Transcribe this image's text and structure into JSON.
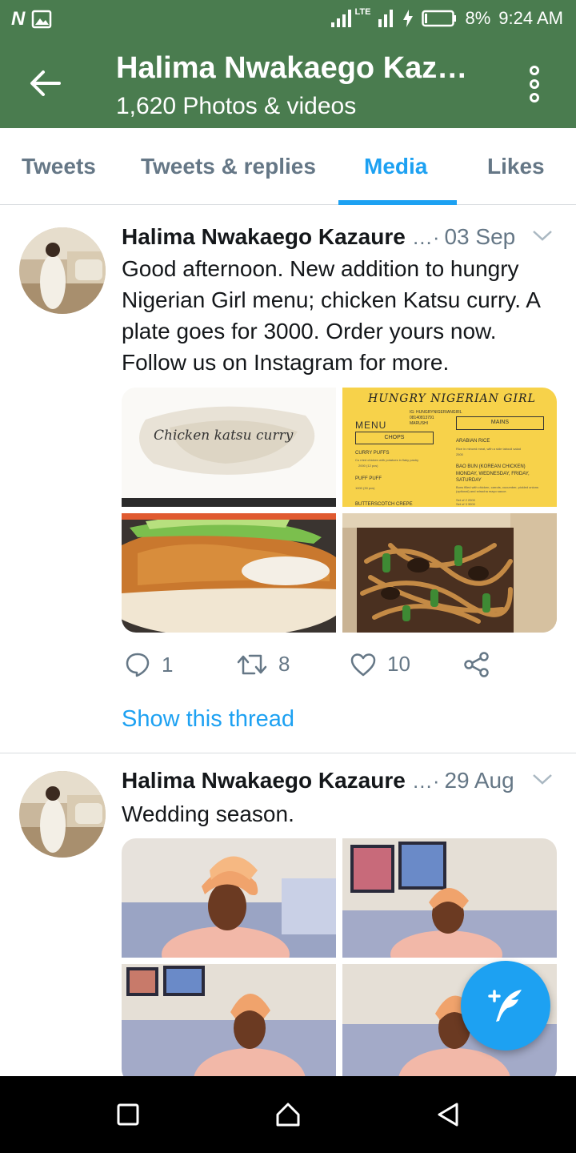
{
  "status_bar": {
    "left_icons": [
      "n-icon",
      "image-icon"
    ],
    "network": "LTE",
    "battery": "8%",
    "time": "9:24 AM"
  },
  "header": {
    "title": "Halima Nwakaego Kaza…",
    "subtitle": "1,620 Photos & videos"
  },
  "tabs": [
    {
      "label": "Tweets",
      "active": false
    },
    {
      "label": "Tweets & replies",
      "active": false
    },
    {
      "label": "Media",
      "active": true
    },
    {
      "label": "Likes",
      "active": false
    }
  ],
  "tweets": [
    {
      "author": "Halima Nwakaego Kazaure",
      "sep": "…·",
      "date": "03 Sep",
      "text": "Good afternoon. New addition to hungry Nigerian Girl menu; chicken Katsu curry. A plate goes for 3000. Order yours now. Follow us on Instagram for more.",
      "media": {
        "img1_text": "Chicken katsu curry",
        "menu_title": "HUNGRY NIGERIAN GIRL",
        "menu_label": "MENU",
        "menu_handle": "IG: HUNGRYNIGERIANGIRL",
        "menu_phone": "08140813791",
        "menu_city": "MARUSHI",
        "chops_label": "CHOPS",
        "mains_label": "MAINS",
        "item_curry_puffs": "CURRY PUFFS",
        "item_curry_puffs_desc": "Cu rried chicken with potatoes in flaky pastry",
        "item_curry_puffs_price": "2000 (12 pcs)",
        "item_puff_puff": "PUFF PUFF",
        "item_puff_puff_price": "1000 (30 pcs)",
        "item_butterscotch": "BUTTERSCOTCH CREPE",
        "item_arabian_rice": "ARABIAN RICE",
        "item_arabian_rice_desc": "Rice in minced meat, with a side tabouli salad",
        "item_arabian_rice_price": "2500",
        "item_bao_bun": "BAO BUN (KOREAN CHICKEN)",
        "item_bao_days": "MONDAY, WEDNESDAY, FRIDAY, SATURDAY",
        "item_bao_desc": "Buns filled with chicken, carrots, cucumber, pickled onions (optional) and sriracha mayo sauce.",
        "item_bao_price_1": "Set of 2 2000",
        "item_bao_price_2": "Set of 3 3000"
      },
      "actions": {
        "replies": "1",
        "retweets": "8",
        "likes": "10"
      },
      "show_thread": "Show this thread"
    },
    {
      "author": "Halima Nwakaego Kazaure",
      "sep": "…·",
      "date": "29 Aug",
      "text": "Wedding season."
    }
  ],
  "colors": {
    "header_bg": "#4a7c4f",
    "accent": "#1da1f2",
    "muted": "#657786"
  }
}
